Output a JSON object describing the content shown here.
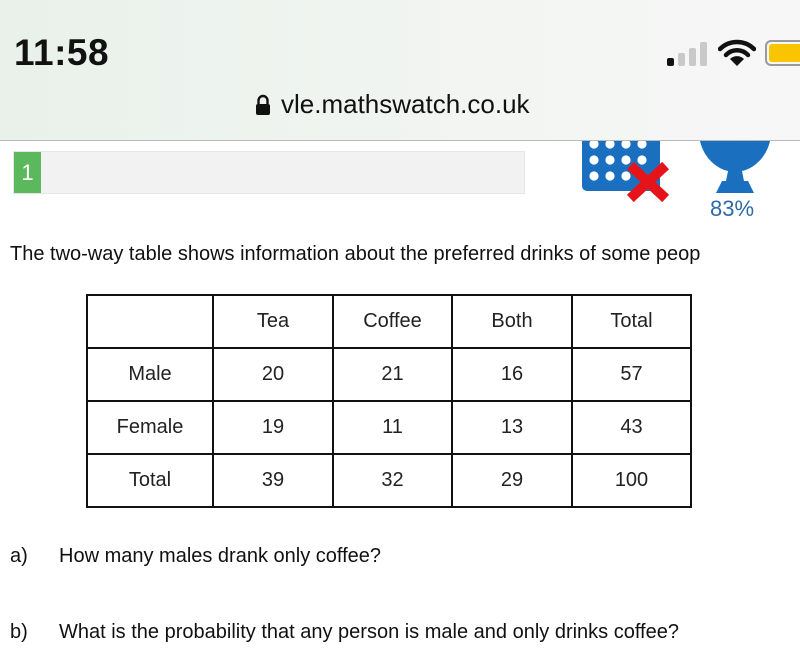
{
  "status_bar": {
    "time": "11:58",
    "signal_bars_active": 1,
    "signal_bars_total": 4,
    "battery_color": "#f8c500"
  },
  "browser": {
    "url": "vle.mathswatch.co.uk",
    "lock_icon": "lock-icon"
  },
  "progress": {
    "segment_label": "1",
    "segment_color": "#5cb85c"
  },
  "score": {
    "grid_icon": "grid-with-cross-icon",
    "trophy_icon": "trophy-icon",
    "percent": "83%",
    "accent": "#1a6fbf",
    "cross_color": "#e5141b"
  },
  "question": {
    "intro": "The two-way table shows information about the preferred drinks of some peop",
    "table": {
      "headers": [
        "",
        "Tea",
        "Coffee",
        "Both",
        "Total"
      ],
      "rows": [
        [
          "Male",
          "20",
          "21",
          "16",
          "57"
        ],
        [
          "Female",
          "19",
          "11",
          "13",
          "43"
        ],
        [
          "Total",
          "39",
          "32",
          "29",
          "100"
        ]
      ]
    },
    "parts": [
      {
        "label": "a)",
        "text": "How many males drank only coffee?"
      },
      {
        "label": "b)",
        "text": "What is the probability that any person is male and only drinks coffee?"
      }
    ]
  }
}
